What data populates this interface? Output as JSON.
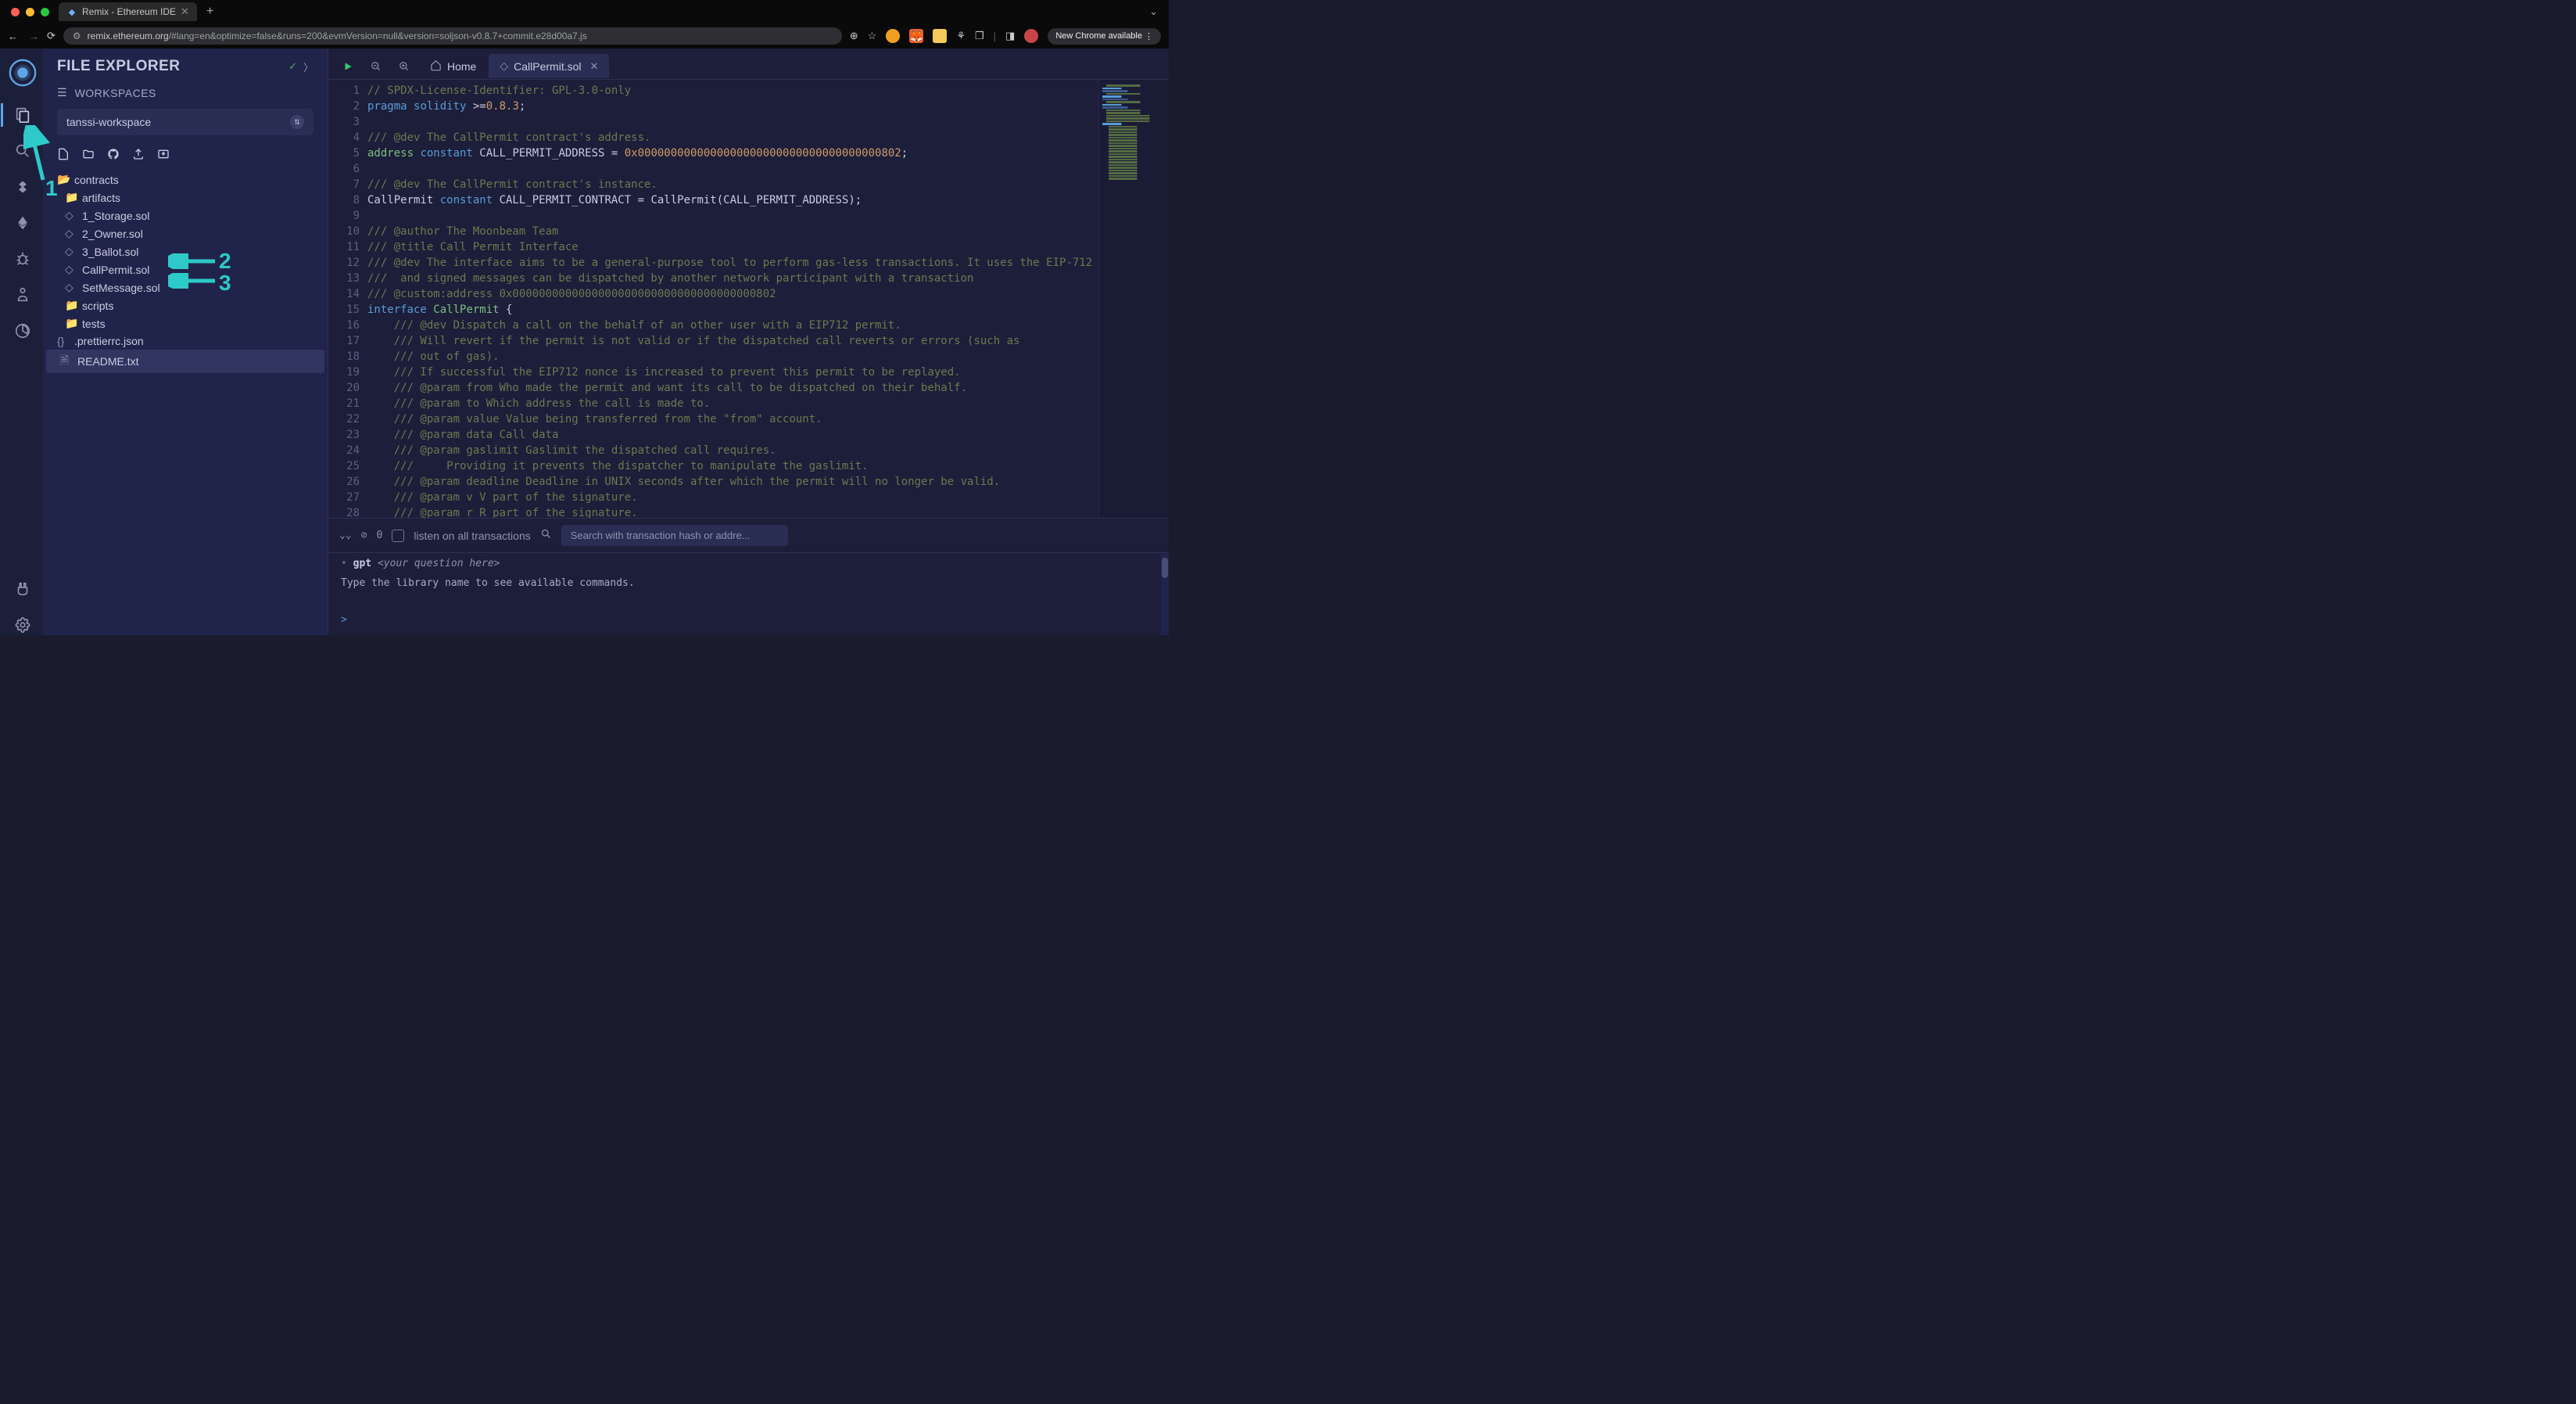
{
  "browser": {
    "tab_title": "Remix - Ethereum IDE",
    "url_host": "remix.ethereum.org",
    "url_path": "/#lang=en&optimize=false&runs=200&evmVersion=null&version=soljson-v0.8.7+commit.e28d00a7.js",
    "new_chrome_label": "New Chrome available"
  },
  "panel": {
    "title": "FILE EXPLORER",
    "workspaces_label": "WORKSPACES",
    "workspace_name": "tanssi-workspace"
  },
  "tree": {
    "contracts": "contracts",
    "artifacts": "artifacts",
    "f1": "1_Storage.sol",
    "f2": "2_Owner.sol",
    "f3": "3_Ballot.sol",
    "f4": "CallPermit.sol",
    "f5": "SetMessage.sol",
    "scripts": "scripts",
    "tests": "tests",
    "prettier": ".prettierrc.json",
    "readme": "README.txt"
  },
  "tabs": {
    "home": "Home",
    "active": "CallPermit.sol"
  },
  "code": {
    "lines": [
      {
        "n": 1,
        "c": "comment",
        "t": "// SPDX-License-Identifier: GPL-3.0-only"
      },
      {
        "n": 2,
        "parts": [
          {
            "c": "keyword",
            "t": "pragma "
          },
          {
            "c": "keyword",
            "t": "solidity "
          },
          {
            "c": "punc",
            "t": ">="
          },
          {
            "c": "version",
            "t": "0.8.3"
          },
          {
            "c": "punc",
            "t": ";"
          }
        ]
      },
      {
        "n": 3,
        "t": ""
      },
      {
        "n": 4,
        "c": "comment",
        "t": "/// @dev The CallPermit contract's address."
      },
      {
        "n": 5,
        "parts": [
          {
            "c": "type",
            "t": "address "
          },
          {
            "c": "keyword",
            "t": "constant "
          },
          {
            "c": "ident",
            "t": "CALL_PERMIT_ADDRESS = "
          },
          {
            "c": "number",
            "t": "0x0000000000000000000000000000000000000802"
          },
          {
            "c": "punc",
            "t": ";"
          }
        ]
      },
      {
        "n": 6,
        "t": ""
      },
      {
        "n": 7,
        "c": "comment",
        "t": "/// @dev The CallPermit contract's instance."
      },
      {
        "n": 8,
        "parts": [
          {
            "c": "ident",
            "t": "CallPermit "
          },
          {
            "c": "keyword",
            "t": "constant "
          },
          {
            "c": "ident",
            "t": "CALL_PERMIT_CONTRACT = CallPermit"
          },
          {
            "c": "punc",
            "t": "("
          },
          {
            "c": "ident",
            "t": "CALL_PERMIT_ADDRESS"
          },
          {
            "c": "punc",
            "t": ");"
          }
        ]
      },
      {
        "n": 9,
        "t": ""
      },
      {
        "n": 10,
        "c": "comment",
        "t": "/// @author The Moonbeam Team"
      },
      {
        "n": 11,
        "c": "comment",
        "t": "/// @title Call Permit Interface"
      },
      {
        "n": 12,
        "c": "comment",
        "t": "/// @dev The interface aims to be a general-purpose tool to perform gas-less transactions. It uses the EIP-712"
      },
      {
        "n": 13,
        "c": "comment",
        "t": "///  and signed messages can be dispatched by another network participant with a transaction"
      },
      {
        "n": 14,
        "c": "comment",
        "t": "/// @custom:address 0x0000000000000000000000000000000000000802"
      },
      {
        "n": 15,
        "parts": [
          {
            "c": "keyword",
            "t": "interface "
          },
          {
            "c": "type",
            "t": "CallPermit "
          },
          {
            "c": "punc",
            "t": "{"
          }
        ]
      },
      {
        "n": 16,
        "indent": 1,
        "c": "comment",
        "t": "/// @dev Dispatch a call on the behalf of an other user with a EIP712 permit."
      },
      {
        "n": 17,
        "indent": 1,
        "c": "comment",
        "t": "/// Will revert if the permit is not valid or if the dispatched call reverts or errors (such as"
      },
      {
        "n": 18,
        "indent": 1,
        "c": "comment",
        "t": "/// out of gas)."
      },
      {
        "n": 19,
        "indent": 1,
        "c": "comment",
        "t": "/// If successful the EIP712 nonce is increased to prevent this permit to be replayed."
      },
      {
        "n": 20,
        "indent": 1,
        "c": "comment",
        "t": "/// @param from Who made the permit and want its call to be dispatched on their behalf."
      },
      {
        "n": 21,
        "indent": 1,
        "c": "comment",
        "t": "/// @param to Which address the call is made to."
      },
      {
        "n": 22,
        "indent": 1,
        "c": "comment",
        "t": "/// @param value Value being transferred from the \"from\" account."
      },
      {
        "n": 23,
        "indent": 1,
        "c": "comment",
        "t": "/// @param data Call data"
      },
      {
        "n": 24,
        "indent": 1,
        "c": "comment",
        "t": "/// @param gaslimit Gaslimit the dispatched call requires."
      },
      {
        "n": 25,
        "indent": 1,
        "c": "comment",
        "t": "///     Providing it prevents the dispatcher to manipulate the gaslimit."
      },
      {
        "n": 26,
        "indent": 1,
        "c": "comment",
        "t": "/// @param deadline Deadline in UNIX seconds after which the permit will no longer be valid."
      },
      {
        "n": 27,
        "indent": 1,
        "c": "comment",
        "t": "/// @param v V part of the signature."
      },
      {
        "n": 28,
        "indent": 1,
        "c": "comment",
        "t": "/// @param r R part of the signature."
      }
    ]
  },
  "terminal": {
    "count": "0",
    "listen_label": "listen on all transactions",
    "search_placeholder": "Search with transaction hash or addre...",
    "gpt_cmd": "gpt",
    "gpt_arg": "<your question here>",
    "help": "Type the library name to see available commands.",
    "prompt": ">"
  },
  "annotations": {
    "n1": "1",
    "n2": "2",
    "n3": "3"
  }
}
